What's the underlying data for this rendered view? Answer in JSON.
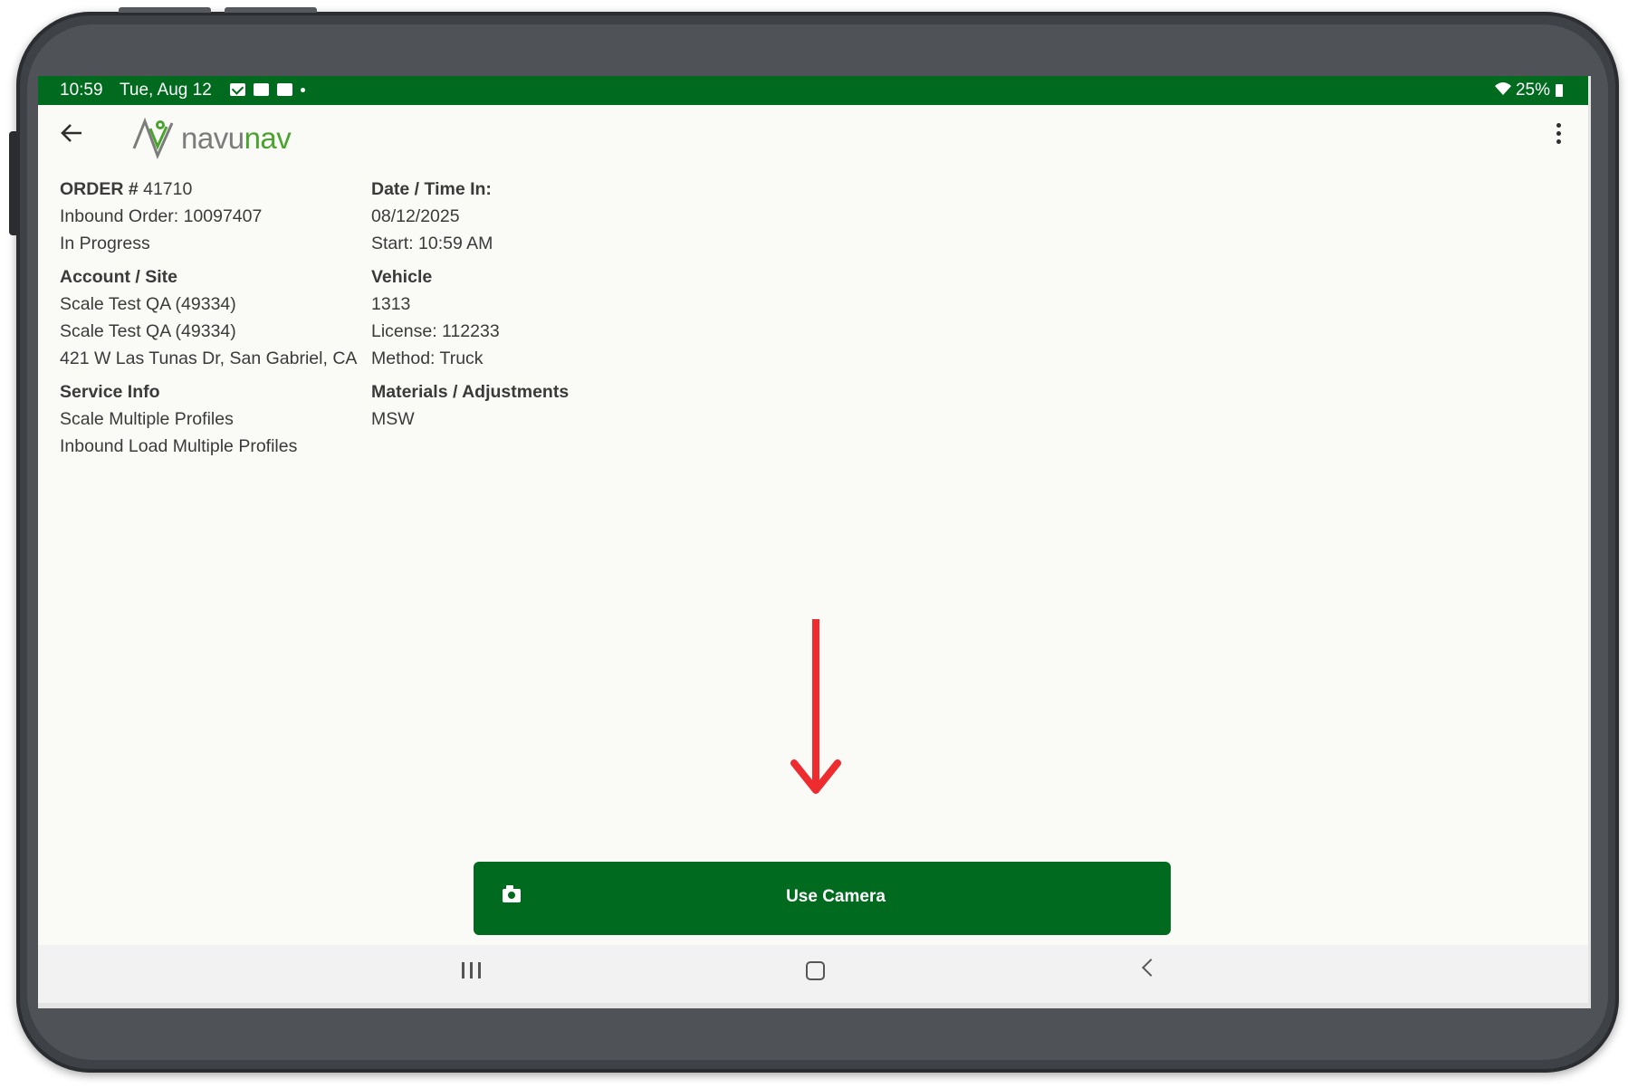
{
  "status_bar": {
    "time": "10:59",
    "date": "Tue, Aug 12",
    "battery": "25%",
    "notification_icons": [
      "mail-icon",
      "outlook-icon",
      "image-icon"
    ]
  },
  "app_bar": {
    "logo_part1": "navu",
    "logo_part2": "nav"
  },
  "order": {
    "number_label": "ORDER #",
    "number": "41710",
    "inbound": "Inbound Order: 10097407",
    "status": "In Progress"
  },
  "account": {
    "heading": "Account / Site",
    "line1": "Scale Test QA (49334)",
    "line2": "Scale Test QA (49334)",
    "address": "421 W Las Tunas Dr, San Gabriel, CA"
  },
  "service": {
    "heading": "Service Info",
    "line1": "Scale Multiple Profiles",
    "line2": "Inbound Load Multiple Profiles"
  },
  "datetime": {
    "heading": "Date / Time In:",
    "date": "08/12/2025",
    "start": "Start: 10:59 AM"
  },
  "vehicle": {
    "heading": "Vehicle",
    "number": "1313",
    "license": "License: 112233",
    "method": "Method: Truck"
  },
  "materials": {
    "heading": "Materials / Adjustments",
    "value": "MSW"
  },
  "camera_button": {
    "label": "Use Camera",
    "icon": "camera-icon"
  },
  "colors": {
    "brand_green": "#006b1e",
    "logo_green": "#4ba32f",
    "arrow_red": "#ee2b2f"
  }
}
